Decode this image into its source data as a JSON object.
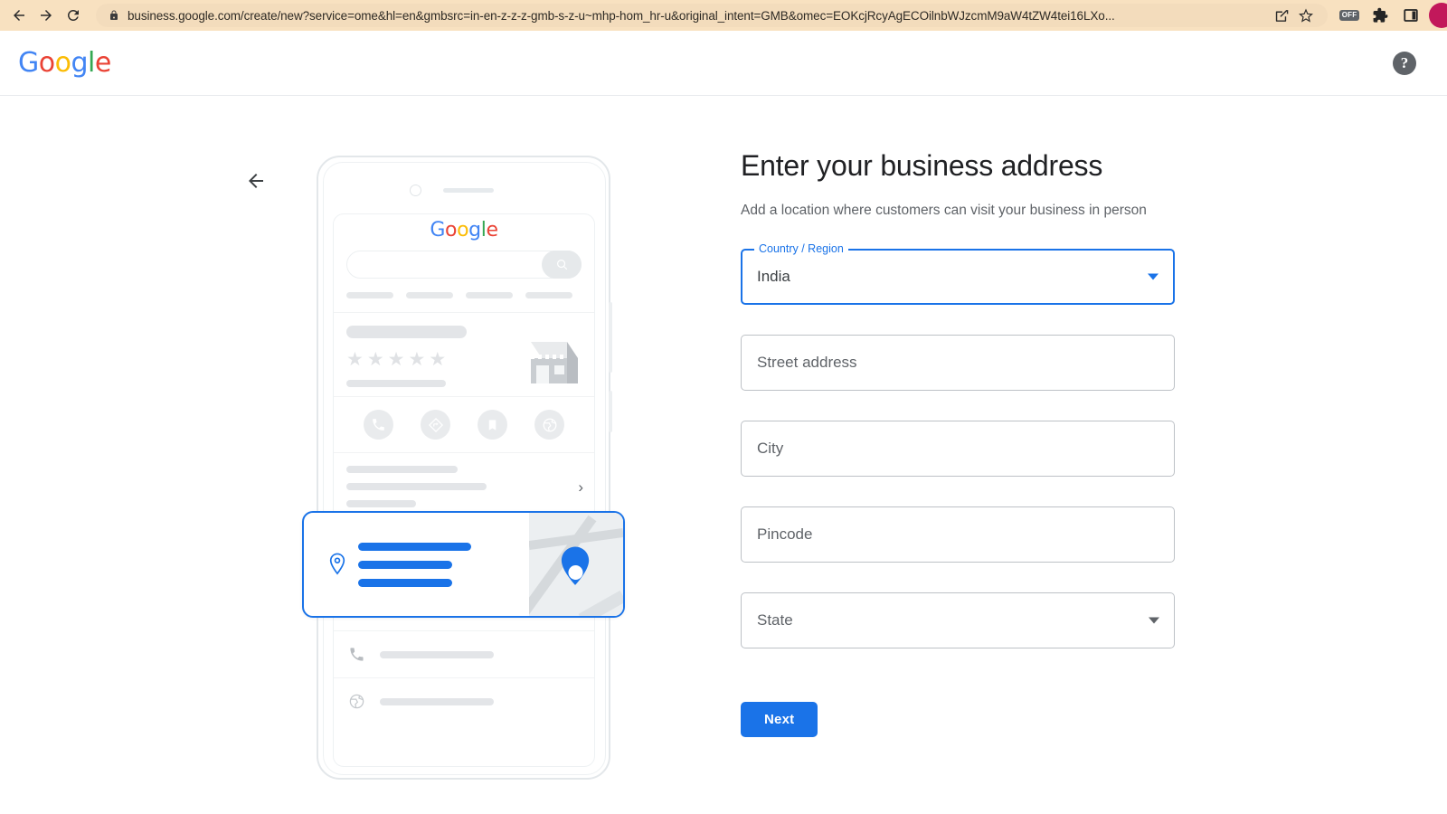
{
  "browser": {
    "url": "business.google.com/create/new?service=ome&hl=en&gmbsrc=in-en-z-z-z-gmb-s-z-u~mhp-hom_hr-u&original_intent=GMB&omec=EOKcjRcyAgECOilnbWJzcmM9aW4tZW4tei16LXo...",
    "back_label": "Back",
    "forward_label": "Forward",
    "reload_label": "Reload",
    "share_label": "Share this page",
    "bookmark_label": "Bookmark this tab",
    "off_badge_label": "OFF",
    "extensions_label": "Extensions",
    "sidepanel_label": "Side panel",
    "profile_label": "Profile"
  },
  "header": {
    "logo_letters": [
      "G",
      "o",
      "o",
      "g",
      "l",
      "e"
    ],
    "help_label": "?"
  },
  "nav": {
    "back_label": "Back"
  },
  "illustration": {
    "phone_logo_letters": [
      "G",
      "o",
      "o",
      "g",
      "l",
      "e"
    ],
    "search_icon": "search-icon",
    "star_glyph": "★",
    "chevron_glyph": "›",
    "action_icons": [
      "phone-icon",
      "directions-icon",
      "bookmark-icon",
      "website-icon"
    ],
    "list_icons": [
      "clock-icon",
      "phone-icon",
      "website-icon"
    ],
    "highlight_card": {
      "pin_icon": "location-pin-icon",
      "map_pin_icon": "map-pin-icon"
    }
  },
  "form": {
    "title": "Enter your business address",
    "subtitle": "Add a location where customers can visit your business in person",
    "fields": [
      {
        "name": "country-region",
        "label": "Country / Region",
        "value": "India",
        "type": "select",
        "focused": true
      },
      {
        "name": "street-address",
        "label": "Street address",
        "value": "",
        "type": "text",
        "focused": false
      },
      {
        "name": "city",
        "label": "City",
        "value": "",
        "type": "text",
        "focused": false
      },
      {
        "name": "pincode",
        "label": "Pincode",
        "value": "",
        "type": "text",
        "focused": false
      },
      {
        "name": "state",
        "label": "State",
        "value": "",
        "type": "select",
        "focused": false
      }
    ],
    "next_label": "Next"
  },
  "colors": {
    "accent": "#1a73e8",
    "chrome": "#f8e1c0",
    "text_primary": "#202124",
    "text_secondary": "#5f6368",
    "avatar": "#c2185b"
  }
}
